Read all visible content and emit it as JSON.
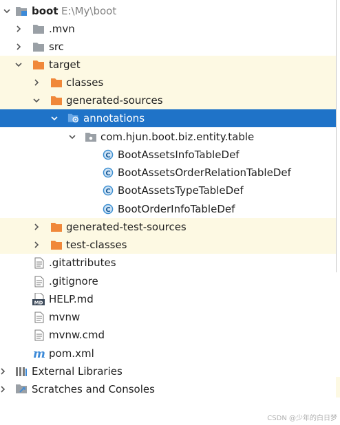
{
  "project": {
    "name": "boot",
    "path": "E:\\My\\boot"
  },
  "items": {
    "mvn": ".mvn",
    "src": "src",
    "target": "target",
    "classes": "classes",
    "generated_sources": "generated-sources",
    "annotations": "annotations",
    "package": "com.hjun.boot.biz.entity.table",
    "class1": "BootAssetsInfoTableDef",
    "class2": "BootAssetsOrderRelationTableDef",
    "class3": "BootAssetsTypeTableDef",
    "class4": "BootOrderInfoTableDef",
    "generated_test_sources": "generated-test-sources",
    "test_classes": "test-classes",
    "gitattributes": ".gitattributes",
    "gitignore": ".gitignore",
    "help": "HELP.md",
    "mvnw": "mvnw",
    "mvnw_cmd": "mvnw.cmd",
    "pom": "pom.xml",
    "external_libraries": "External Libraries",
    "scratches": "Scratches and Consoles"
  },
  "icons": {
    "md_badge": "MD",
    "class_badge": "C",
    "maven_badge": "m"
  },
  "watermark": "CSDN @少年的白日梦",
  "colors": {
    "selection": "#1f73c8",
    "excluded_bg": "#fdf9e3",
    "folder_orange": "#f0883a",
    "folder_gray": "#9aa0a6",
    "folder_blue": "#3c8ad8",
    "class_circle": "#3d8fd1"
  }
}
